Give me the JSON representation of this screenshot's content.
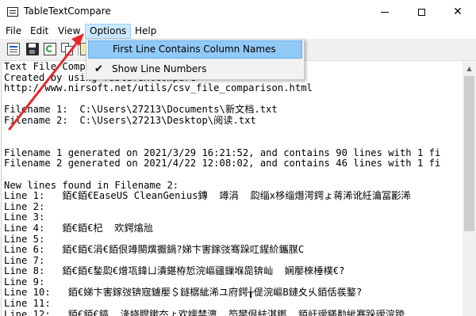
{
  "window": {
    "title": "TableTextCompare",
    "minimize_icon": "minimize-icon",
    "maximize_icon": "maximize-icon",
    "close_icon": "close-icon"
  },
  "menu": {
    "items": [
      "File",
      "Edit",
      "View",
      "Options",
      "Help"
    ],
    "active": "Options"
  },
  "toolbar": {
    "icons": [
      "new-report-icon",
      "save-icon",
      "refresh-icon",
      "copy-icon",
      "properties-icon"
    ]
  },
  "options_menu": {
    "items": [
      {
        "label": "First Line Contains Column Names",
        "checked": false,
        "highlighted": true
      },
      {
        "label": "Show Line Numbers",
        "checked": true,
        "highlighted": false
      }
    ],
    "check_glyph": "✔"
  },
  "report": {
    "lines": [
      "Text File Compare",
      "Created by using TableTextCompare",
      "http://www.nirsoft.net/utils/csv_file_comparison.html",
      "",
      "Filename 1:  C:\\Users\\27213\\Documents\\新文档.txt",
      "Filename 2:  C:\\Users\\27213\\Desktop\\阅读.txt",
      "",
      "",
      "Filename 1 generated on 2021/3/29 16:21:52, and contains 90 lines with 1 fi",
      "Filename 2 generated on 2021/4/22 12:08:02, and contains 46 lines with 1 fi",
      "",
      "New lines found in Filename 2:",
      "Line 1:   銆€銆€EaseUS CleanGenius鏄  竴涓  瓝缁х栘缁熸湂鍔ょ蒋浠讹紝瀹冨彲浠",
      "Line 2:",
      "Line 3:",
      "Line 4:   銆€銆€杞  欢鍔熻兘",
      "Line 5:",
      "Line 6:   銆€銆€涓€銆佷竴閿熼擫鍋?娣卞害鎵弢骞跺叿鍟紒鑴腜C",
      "Line 7:",
      "Line 8:   銆€銆€鍫瓝€熷瓨鍏ㄩ潰鍖栫悊浣嶇疆鏁堢巼锛屾  娴嬮棶棰樸€?",
      "Line 9:",
      "Line 10:   銆€娣卞害鎵弢锛宼鐪嬮＄鐩樼紪浠ユ府鍔╁偍浣嶇Β鏈夊乆銆佸彂鐜?",
      "Line 11:",
      "Line 12:   銆€銆€鎬  湰娆睅鏉冭ょ欢嬬禁澶  笉鐢佷紶淇鎯  銆屽叆鏋勫紪骞跺叆浣跨"
    ]
  },
  "annotation": {
    "arrow_color": "#e8262a"
  }
}
